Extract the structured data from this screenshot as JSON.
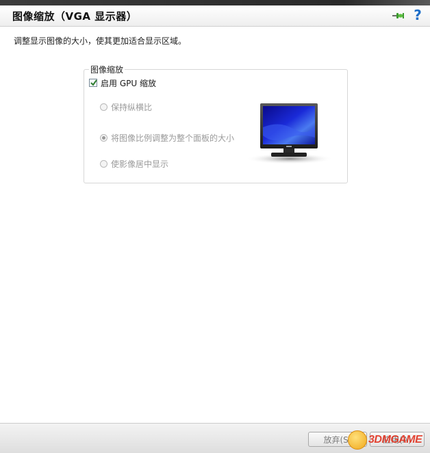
{
  "header": {
    "title": "图像缩放（VGA 显示器）",
    "pin_icon": "pin-icon",
    "help_icon": "help-icon",
    "help_glyph": "?"
  },
  "description": "调整显示图像的大小，使其更加适合显示区域。",
  "scaling_group": {
    "title": "图像缩放",
    "gpu_checkbox": {
      "label": "启用 GPU 缩放",
      "checked": true
    },
    "radios": [
      {
        "label": "保持纵横比",
        "selected": false,
        "enabled": false
      },
      {
        "label": "将图像比例调整为整个面板的大小",
        "selected": true,
        "enabled": false
      },
      {
        "label": "使影像居中显示",
        "selected": false,
        "enabled": false
      }
    ],
    "preview_icon": "monitor-icon"
  },
  "footer": {
    "discard_label": "放弃(S)",
    "apply_label": "应用(A)"
  },
  "watermark": {
    "text": "3DMGAME"
  },
  "colors": {
    "accent": "#1f6fc9",
    "disabled_text": "#9a9a9a",
    "watermark": "#e2311f"
  }
}
